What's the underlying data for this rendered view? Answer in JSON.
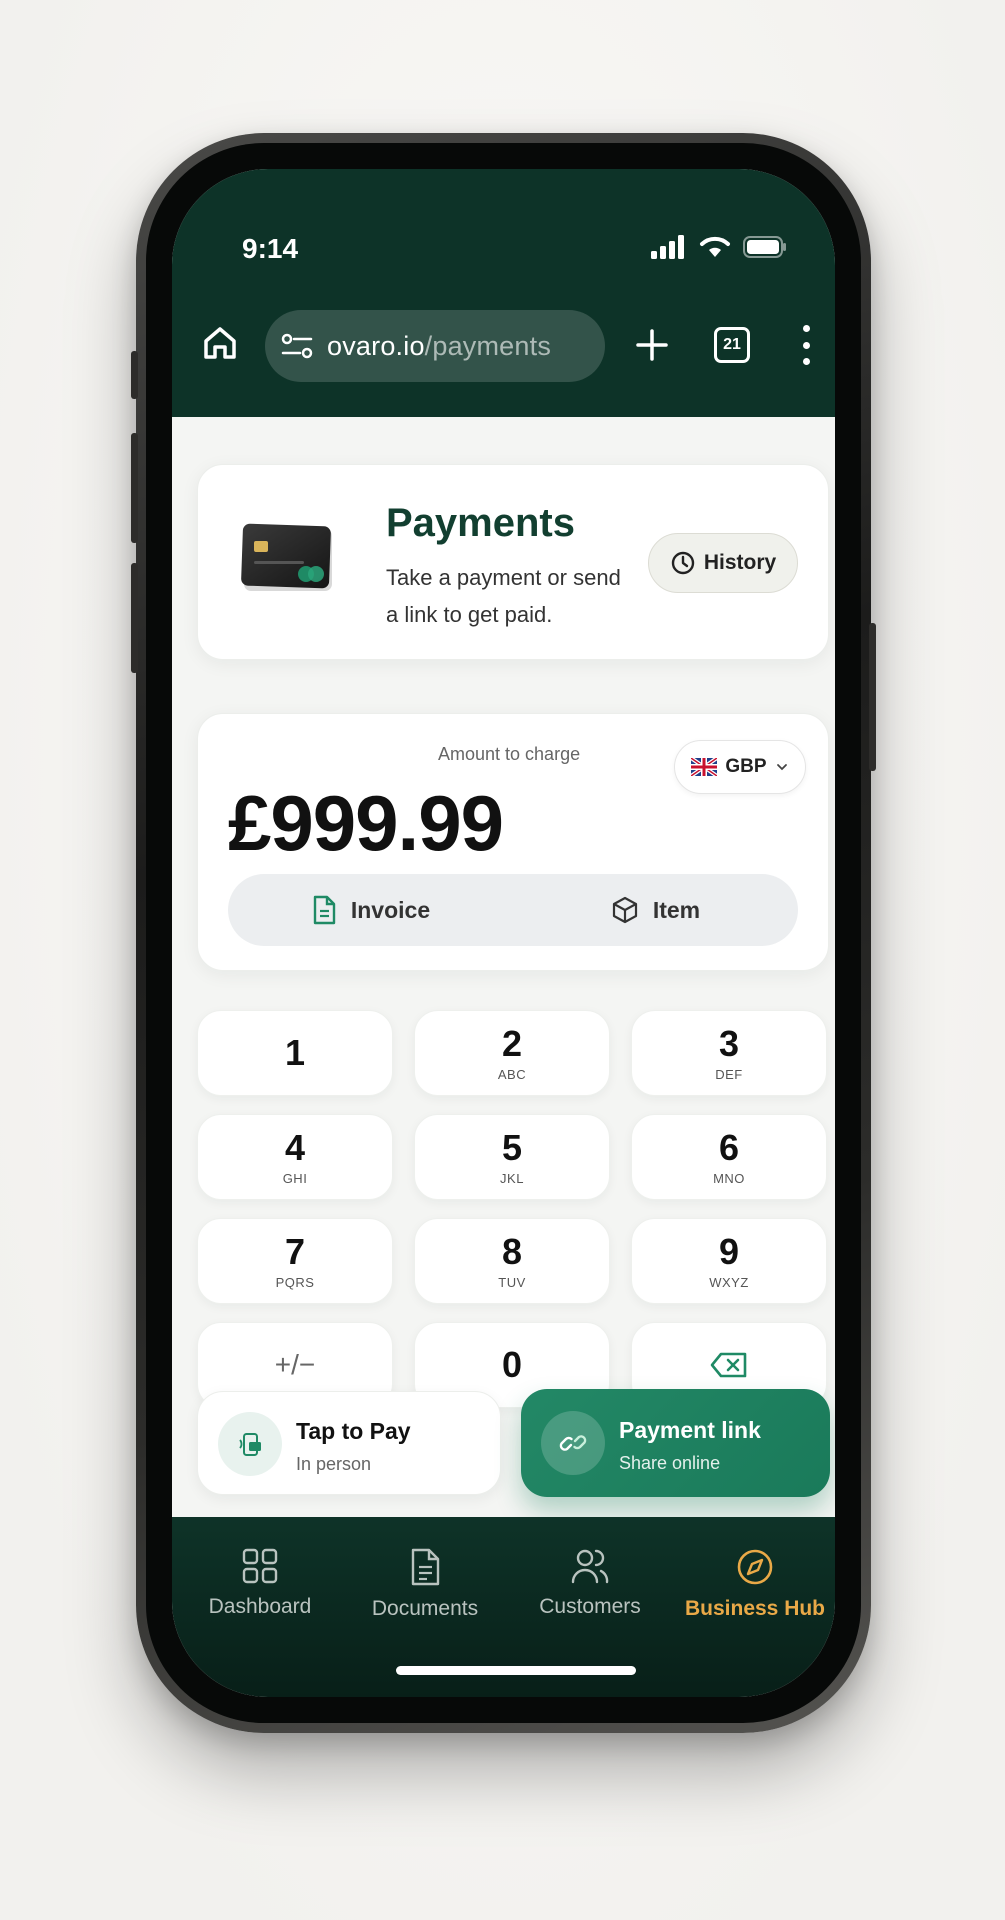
{
  "status": {
    "time": "9:14"
  },
  "browser": {
    "url_host": "ovaro.io",
    "url_path": "/payments",
    "tab_count": "21"
  },
  "header": {
    "title": "Payments",
    "subtitle": "Take a payment or send a link to get paid.",
    "history_label": "History"
  },
  "amount": {
    "label": "Amount to charge",
    "value": "£999.99",
    "currency": "GBP",
    "options": [
      {
        "label": "Invoice",
        "icon": "document-icon"
      },
      {
        "label": "Item",
        "icon": "box-icon"
      }
    ]
  },
  "keypad": [
    {
      "digit": "1",
      "letters": ""
    },
    {
      "digit": "2",
      "letters": "ABC"
    },
    {
      "digit": "3",
      "letters": "DEF"
    },
    {
      "digit": "4",
      "letters": "GHI"
    },
    {
      "digit": "5",
      "letters": "JKL"
    },
    {
      "digit": "6",
      "letters": "MNO"
    },
    {
      "digit": "7",
      "letters": "PQRS"
    },
    {
      "digit": "8",
      "letters": "TUV"
    },
    {
      "digit": "9",
      "letters": "WXYZ"
    },
    {
      "digit": "+/−",
      "letters": ""
    },
    {
      "digit": "0",
      "letters": ""
    }
  ],
  "actions": {
    "tap": {
      "title": "Tap to Pay",
      "subtitle": "In person"
    },
    "link": {
      "title": "Payment link",
      "subtitle": "Share online"
    }
  },
  "nav": [
    {
      "label": "Dashboard",
      "icon": "grid-icon"
    },
    {
      "label": "Documents",
      "icon": "document-icon"
    },
    {
      "label": "Customers",
      "icon": "users-icon"
    },
    {
      "label": "Business Hub",
      "icon": "compass-icon",
      "active": true
    }
  ],
  "colors": {
    "brand_dark": "#0d3328",
    "accent_green": "#1f8a65",
    "nav_active": "#e9a947"
  }
}
